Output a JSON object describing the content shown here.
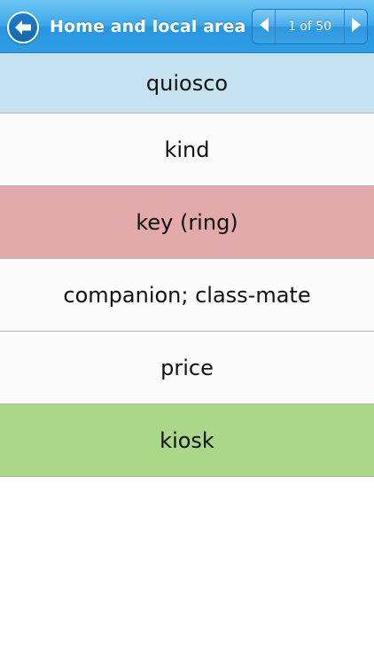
{
  "header": {
    "title": "Home and local area",
    "pager_label": "1 of 50",
    "back_icon": "back-arrow-icon",
    "prev_icon": "chevron-left-icon",
    "next_icon": "chevron-right-icon",
    "bar_color": "#3aa8ea"
  },
  "answers": [
    {
      "label": "quiosco",
      "state": "selected",
      "color": "#c5e2f1"
    },
    {
      "label": "kind",
      "state": "normal",
      "color": "#fbfbfb"
    },
    {
      "label": "key (ring)",
      "state": "wrong",
      "color": "#e3aaab"
    },
    {
      "label": "companion; class-mate",
      "state": "normal",
      "color": "#fbfbfb"
    },
    {
      "label": "price",
      "state": "normal",
      "color": "#fbfbfb"
    },
    {
      "label": "kiosk",
      "state": "correct",
      "color": "#aad888"
    }
  ]
}
